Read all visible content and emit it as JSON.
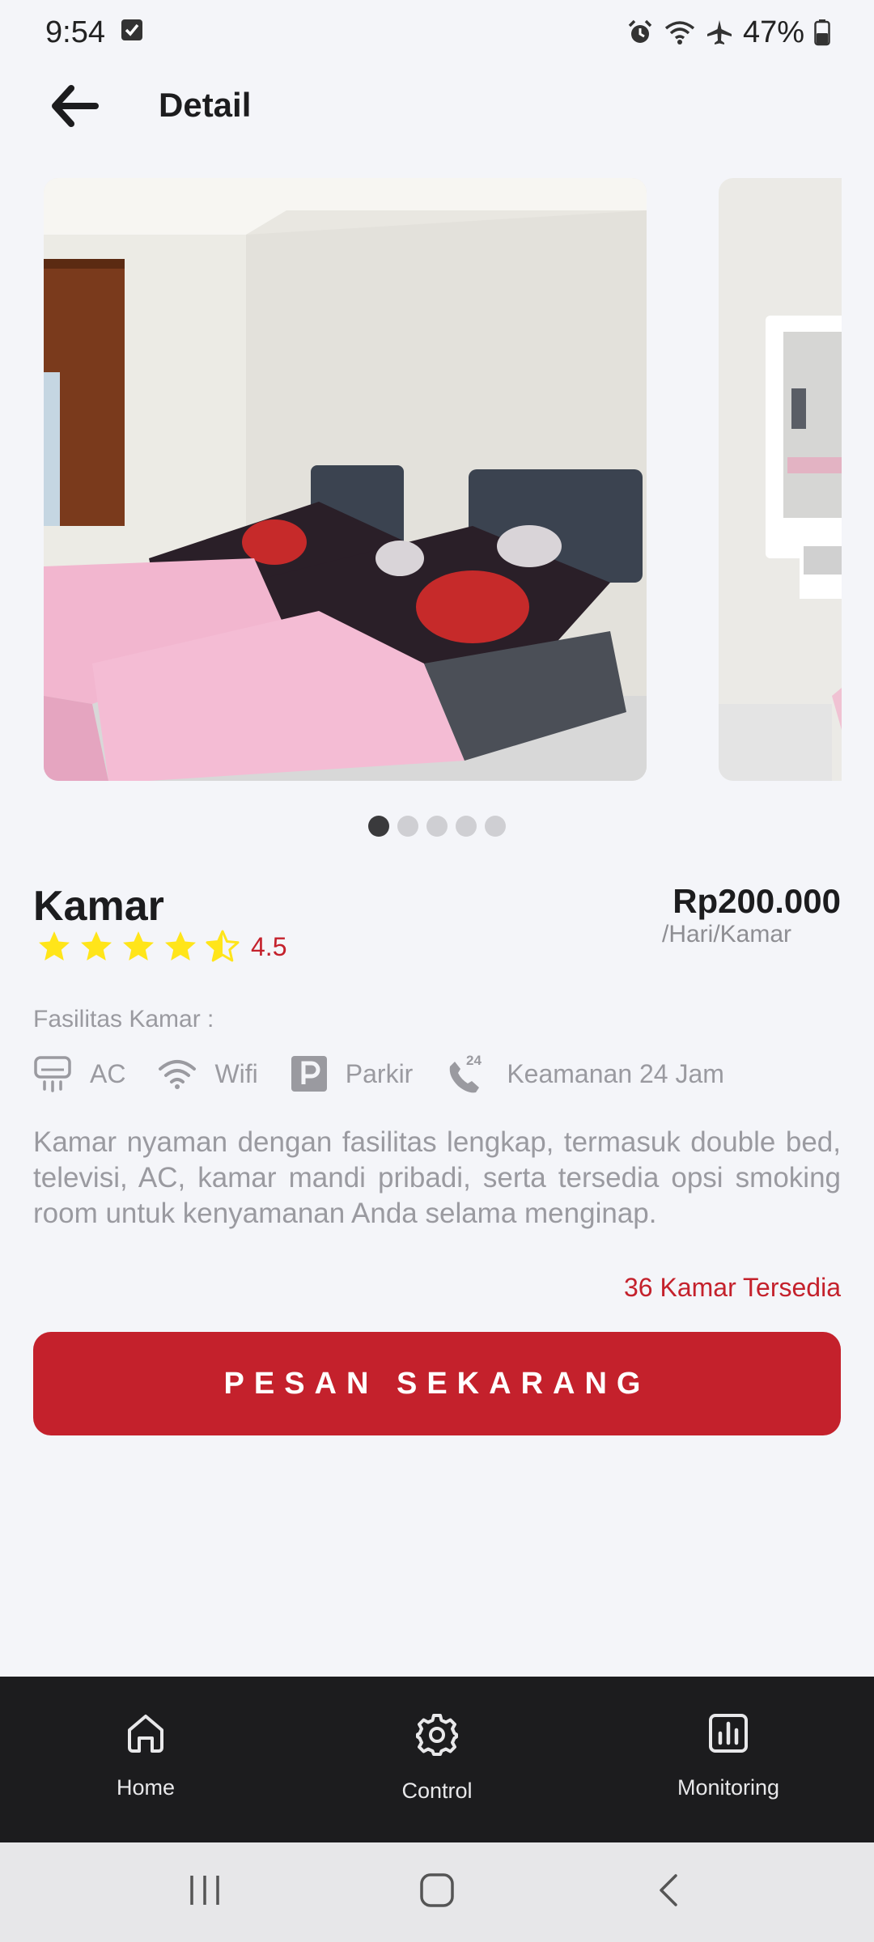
{
  "status_bar": {
    "time": "9:54",
    "battery": "47%",
    "icons": [
      "checkbox-notification-icon",
      "alarm-icon",
      "wifi-icon",
      "airplane-mode-icon",
      "battery-icon"
    ]
  },
  "header": {
    "title": "Detail",
    "back_icon": "arrow-left-icon"
  },
  "carousel": {
    "slide_count": 5,
    "active_index": 0,
    "slides": [
      "room-photo-twin-beds",
      "room-photo-vanity-mirror"
    ]
  },
  "room": {
    "name": "Kamar",
    "rating_value": "4.5",
    "rating": 4.5,
    "rating_max": 5,
    "price": "Rp200.000",
    "price_unit": "/Hari/Kamar"
  },
  "facilities": {
    "label": "Fasilitas Kamar :",
    "items": [
      {
        "icon": "air-conditioner-icon",
        "label": "AC"
      },
      {
        "icon": "wifi-icon",
        "label": "Wifi"
      },
      {
        "icon": "parking-icon",
        "label": "Parkir"
      },
      {
        "icon": "phone-24-icon",
        "label": "Keamanan 24 Jam"
      }
    ]
  },
  "description": "Kamar nyaman dengan fasilitas lengkap, termasuk double bed, televisi, AC, kamar mandi pribadi, serta tersedia opsi smoking room untuk kenyamanan Anda selama menginap.",
  "availability": "36 Kamar Tersedia",
  "book_button": "PESAN SEKARANG",
  "bottom_nav": {
    "items": [
      {
        "icon": "home-icon",
        "label": "Home"
      },
      {
        "icon": "gear-icon",
        "label": "Control"
      },
      {
        "icon": "bar-chart-icon",
        "label": "Monitoring"
      }
    ]
  },
  "system_nav": [
    "recents-icon",
    "home-circle-icon",
    "back-chevron-icon"
  ],
  "colors": {
    "accent": "#c4212c",
    "star": "#ffe51a",
    "background": "#f4f5f9",
    "nav_bar": "#1c1c1e"
  }
}
